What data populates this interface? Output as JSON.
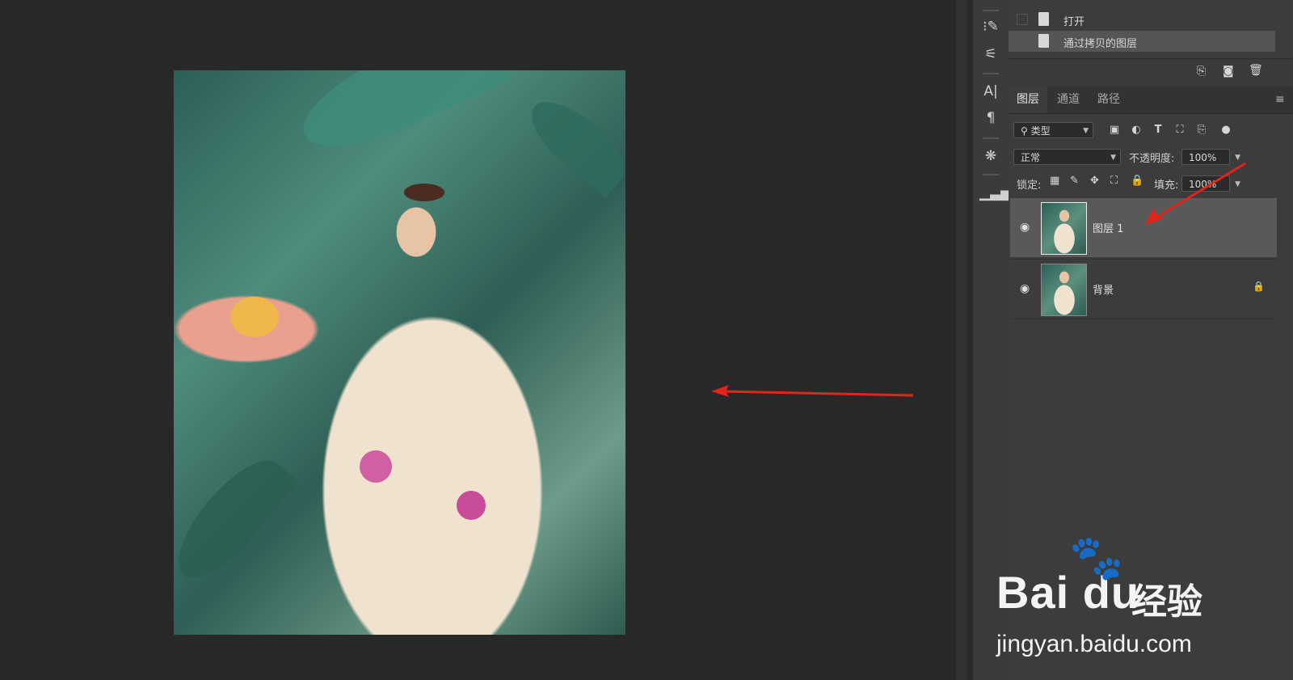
{
  "history": {
    "items": [
      {
        "label": "打开"
      },
      {
        "label": "通过拷贝的图层"
      }
    ]
  },
  "layers_panel": {
    "tabs": [
      {
        "label": "图层"
      },
      {
        "label": "通道"
      },
      {
        "label": "路径"
      }
    ],
    "filter_select": "类型",
    "blend_mode": "正常",
    "opacity_label": "不透明度:",
    "opacity_value": "100%",
    "lock_label": "锁定:",
    "fill_label": "填充:",
    "fill_value": "100%",
    "layers": [
      {
        "name": "图层 1",
        "selected": true
      },
      {
        "name": "背景",
        "locked": true
      }
    ]
  },
  "annotations": {
    "arrow_color": "#e3241b"
  },
  "watermark": {
    "brand": "Bai du",
    "product": "经验",
    "url": "jingyan.baidu.com"
  },
  "colors": {
    "canvas_bg": "#282828",
    "panel_bg": "#3c3c3c",
    "selected_layer_bg": "#595959"
  }
}
